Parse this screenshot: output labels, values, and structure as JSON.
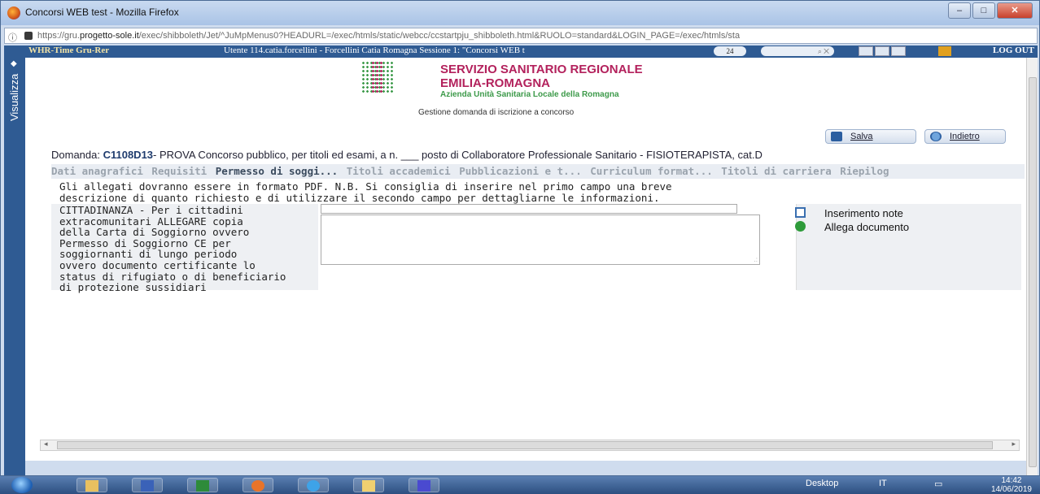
{
  "window": {
    "title": "Concorsi WEB test - Mozilla Firefox",
    "min": "–",
    "max": "□",
    "close": "✕"
  },
  "browser": {
    "info_icon": "ⓘ",
    "url_prefix": "https://gru.",
    "url_domain": "progetto-sole.it",
    "url_rest": "/exec/shibboleth/Jet/^JuMpMenus0?HEADURL=/exec/htmls/static/webcc/ccstartpju_shibboleth.html&RUOLO=standard&LOGIN_PAGE=/exec/htmls/sta"
  },
  "appbar": {
    "brand": "WHR-Time Gru-Rer",
    "user": "Utente 114.catia.forcellini - Forcellini Catia Romagna   Sessione 1: \"Concorsi WEB t",
    "badge": "24",
    "logout": "LOG OUT"
  },
  "sidebar": {
    "label": "Visualizza",
    "arrow": "◆"
  },
  "header": {
    "org_line1": "SERVIZIO SANITARIO REGIONALE",
    "org_line2": "EMILIA-ROMAGNA",
    "org_line3": "Azienda Unità Sanitaria Locale della Romagna",
    "subtitle": "Gestione domanda di iscrizione a concorso"
  },
  "toolbar": {
    "save_label": "Salva",
    "back_label": "Indietro"
  },
  "domanda": {
    "prefix": "Domanda: ",
    "code": "C1108D13",
    "text": "- PROVA Concorso pubblico, per titoli ed esami, a n. ___ posto di Collaboratore Professionale Sanitario - FISIOTERAPISTA, cat.D"
  },
  "tabs": [
    {
      "label": "Dati anagrafici"
    },
    {
      "label": "Requisiti"
    },
    {
      "label": "Permesso di soggi..."
    },
    {
      "label": "Titoli accademici"
    },
    {
      "label": "Pubblicazioni e t..."
    },
    {
      "label": "Curriculum format..."
    },
    {
      "label": "Titoli di carriera"
    },
    {
      "label": "Riepilog"
    }
  ],
  "active_tab": "Permesso di soggi...",
  "info": {
    "line1": "Gli allegati dovranno essere in formato PDF. N.B. Si consiglia di inserire nel primo campo una breve",
    "line2": "descrizione di quanto richiesto e di utilizzare il secondo campo per dettagliarne le informazioni."
  },
  "form": {
    "cittadinanza": [
      "CITTADINANZA - Per i cittadini",
      "extracomunitari ALLEGARE copia",
      "della Carta di Soggiorno ovvero",
      "Permesso di Soggiorno CE per",
      "soggiornanti di lungo periodo",
      "ovvero documento certificante lo",
      "status di rifugiato o di beneficiario",
      "di protezione sussidiari"
    ],
    "short_value": "",
    "long_value": "",
    "action_notes": "Inserimento note",
    "action_attach": "Allega documento"
  },
  "scrollbar": {
    "left_arrow": "◂",
    "right_arrow": "▸",
    "grip": "III"
  },
  "taskbar": {
    "desktop": "Desktop",
    "lang": "IT",
    "time": "14:42",
    "date": "14/06/2019"
  }
}
